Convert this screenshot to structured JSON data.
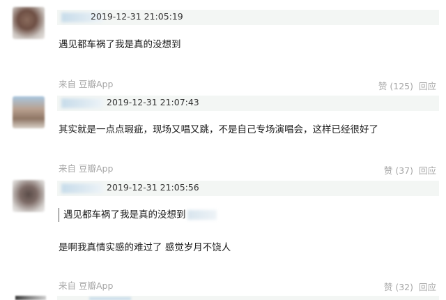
{
  "comments": [
    {
      "timestamp": "2019-12-31 21:05:19",
      "text": "遇见都车祸了我是真的没想到",
      "source": "来自 豆瓣App",
      "likes": "赞 (125)",
      "reply": "回应"
    },
    {
      "timestamp": "2019-12-31 21:07:43",
      "text": "其实就是一点点瑕疵，现场又唱又跳，不是自己专场演唱会，这样已经很好了",
      "source": "来自 豆瓣App",
      "likes": "赞 (37)",
      "reply": "回应"
    },
    {
      "timestamp": "2019-12-31 21:05:56",
      "quote": "遇见都车祸了我是真的没想到",
      "text": "是啊我真情实感的难过了 感觉岁月不饶人",
      "source": "来自 豆瓣App",
      "likes": "赞 (32)",
      "reply": "回应"
    }
  ]
}
